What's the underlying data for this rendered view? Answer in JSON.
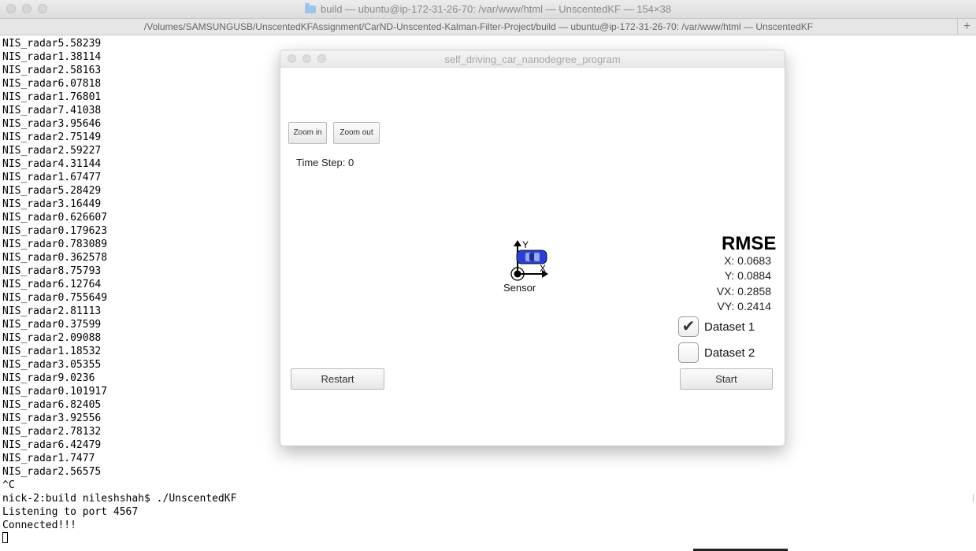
{
  "terminal": {
    "window_title": "build — ubuntu@ip-172-31-26-70: /var/www/html — UnscentedKF — 154×38",
    "tab_title": "/Volumes/SAMSUNGUSB/UnscentedKFAssignment/CarND-Unscented-Kalman-Filter-Project/build — ubuntu@ip-172-31-26-70: /var/www/html — UnscentedKF",
    "lines": [
      "NIS_radar5.58239",
      "NIS_radar1.38114",
      "NIS_radar2.58163",
      "NIS_radar6.07818",
      "NIS_radar1.76801",
      "NIS_radar7.41038",
      "NIS_radar3.95646",
      "NIS_radar2.75149",
      "NIS_radar2.59227",
      "NIS_radar4.31144",
      "NIS_radar1.67477",
      "NIS_radar5.28429",
      "NIS_radar3.16449",
      "NIS_radar0.626607",
      "NIS_radar0.179623",
      "NIS_radar0.783089",
      "NIS_radar0.362578",
      "NIS_radar8.75793",
      "NIS_radar6.12764",
      "NIS_radar0.755649",
      "NIS_radar2.81113",
      "NIS_radar0.37599",
      "NIS_radar2.09088",
      "NIS_radar1.18532",
      "NIS_radar3.05355",
      "NIS_radar9.0236",
      "NIS_radar0.101917",
      "NIS_radar6.82405",
      "NIS_radar3.92556",
      "NIS_radar2.78132",
      "NIS_radar6.42479",
      "NIS_radar1.7477",
      "NIS_radar2.56575",
      "^C",
      "nick-2:build nileshshah$ ./UnscentedKF",
      "Listening to port 4567",
      "Connected!!!"
    ]
  },
  "simulator": {
    "title": "self_driving_car_nanodegree_program",
    "zoom_in_label": "Zoom in",
    "zoom_out_label": "Zoom out",
    "time_step": "Time Step: 0",
    "rmse": {
      "title": "RMSE",
      "x": "X: 0.0683",
      "y": "Y: 0.0884",
      "vx": "VX: 0.2858",
      "vy": "VY: 0.2414"
    },
    "dataset1_label": "Dataset 1",
    "dataset1_checked": true,
    "dataset2_label": "Dataset 2",
    "dataset2_checked": false,
    "restart_label": "Restart",
    "start_label": "Start",
    "sensor_label": "Sensor",
    "axis_x_label": "X",
    "axis_y_label": "Y",
    "car_color": "#2a3fd6"
  }
}
